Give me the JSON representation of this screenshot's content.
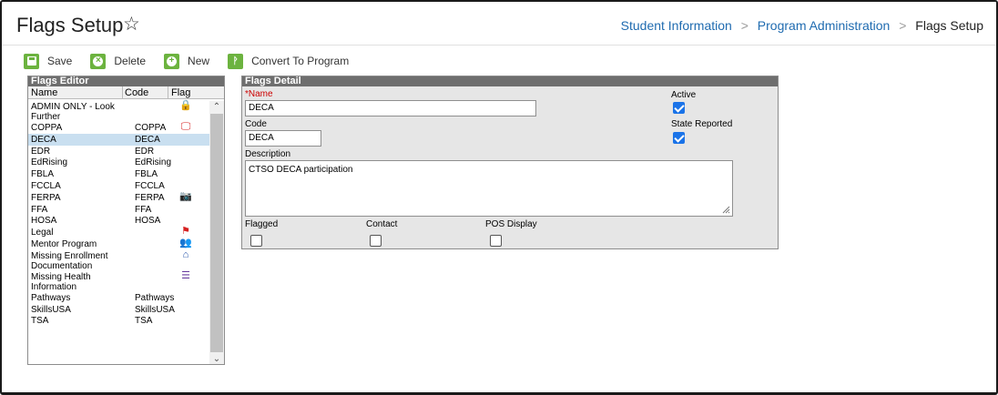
{
  "header": {
    "title": "Flags Setup",
    "star": "☆",
    "breadcrumb": [
      "Student Information",
      "Program Administration"
    ],
    "current": "Flags Setup",
    "sep": ">"
  },
  "toolbar": {
    "save": "Save",
    "delete": "Delete",
    "new": "New",
    "convert": "Convert To Program"
  },
  "editor": {
    "title": "Flags Editor",
    "columns": {
      "name": "Name",
      "code": "Code",
      "flag": "Flag"
    },
    "rows": [
      {
        "name": "ADMIN ONLY - Look Further",
        "code": "",
        "icon": "lock-icon",
        "glyph": "🔒",
        "color": "#1f4fa8"
      },
      {
        "name": "COPPA",
        "code": "COPPA",
        "icon": "monitor-icon",
        "glyph": "🖵",
        "color": "#d62020"
      },
      {
        "name": "DECA",
        "code": "DECA",
        "icon": "",
        "glyph": "",
        "color": "",
        "selected": true
      },
      {
        "name": "EDR",
        "code": "EDR",
        "icon": "",
        "glyph": "",
        "color": ""
      },
      {
        "name": "EdRising",
        "code": "EdRising",
        "icon": "",
        "glyph": "",
        "color": ""
      },
      {
        "name": "FBLA",
        "code": "FBLA",
        "icon": "",
        "glyph": "",
        "color": ""
      },
      {
        "name": "FCCLA",
        "code": "FCCLA",
        "icon": "",
        "glyph": "",
        "color": ""
      },
      {
        "name": "FERPA",
        "code": "FERPA",
        "icon": "camera-icon",
        "glyph": "📷",
        "color": "#d62020"
      },
      {
        "name": "FFA",
        "code": "FFA",
        "icon": "",
        "glyph": "",
        "color": ""
      },
      {
        "name": "HOSA",
        "code": "HOSA",
        "icon": "",
        "glyph": "",
        "color": ""
      },
      {
        "name": "Legal",
        "code": "",
        "icon": "flag-icon",
        "glyph": "⚑",
        "color": "#d62020"
      },
      {
        "name": "Mentor Program",
        "code": "",
        "icon": "users-icon",
        "glyph": "👥",
        "color": "#4caf50"
      },
      {
        "name": "Missing Enrollment Documentation",
        "code": "",
        "icon": "home-icon",
        "glyph": "⌂",
        "color": "#1f4fa8"
      },
      {
        "name": "Missing Health Information",
        "code": "",
        "icon": "checklist-icon",
        "glyph": "☰",
        "color": "#6a3fa0"
      },
      {
        "name": "Pathways",
        "code": "Pathways",
        "icon": "",
        "glyph": "",
        "color": ""
      },
      {
        "name": "SkillsUSA",
        "code": "SkillsUSA",
        "icon": "",
        "glyph": "",
        "color": ""
      },
      {
        "name": "TSA",
        "code": "TSA",
        "icon": "",
        "glyph": "",
        "color": ""
      }
    ]
  },
  "detail": {
    "title": "Flags Detail",
    "name_label": "*Name",
    "name_value": "DECA",
    "code_label": "Code",
    "code_value": "DECA",
    "description_label": "Description",
    "description_value": "CTSO DECA participation",
    "active_label": "Active",
    "active": true,
    "state_reported_label": "State Reported",
    "state_reported": true,
    "flagged_label": "Flagged",
    "flagged": false,
    "contact_label": "Contact",
    "contact": false,
    "pos_display_label": "POS Display",
    "pos_display": false
  },
  "colors": {
    "accent_green": "#6cb33f",
    "link_blue": "#1f6bb0",
    "selected_row": "#c9dff0",
    "checkbox_blue": "#1a73e8"
  }
}
